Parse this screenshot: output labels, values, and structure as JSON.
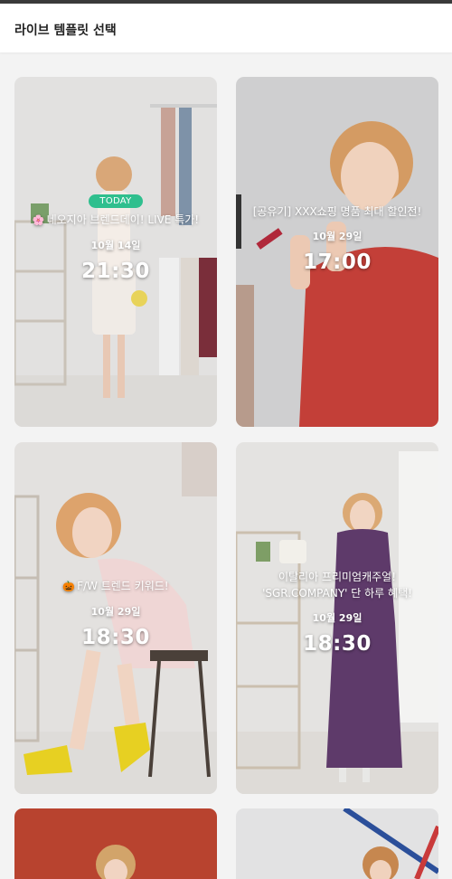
{
  "header": {
    "title": "라이브 템플릿 선택"
  },
  "cards": [
    {
      "badge": "TODAY",
      "icon": "🌸",
      "title": "네오지아 브렌드데이! LIVE 특가!",
      "date": "10월 14일",
      "time": "21:30"
    },
    {
      "title": "[공유기] XXX쇼핑 명품 최대 할인전!",
      "date": "10월 29일",
      "time": "17:00"
    },
    {
      "icon": "🎃",
      "title": "F/W 트렌드 키워드!",
      "date": "10월 29일",
      "time": "18:30"
    },
    {
      "title": "이탈리아 프리미엄캐주얼! 'SGR.COMPANY' 단 하루 혜택!",
      "date": "10월 29일",
      "time": "18:30"
    }
  ]
}
